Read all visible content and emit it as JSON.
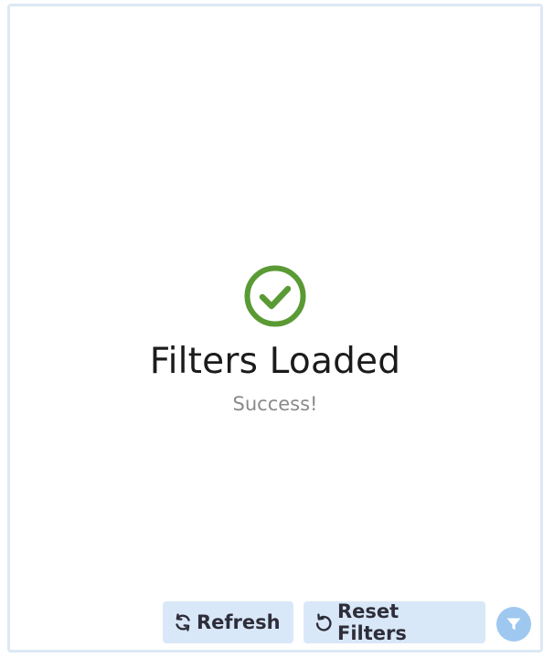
{
  "status": {
    "title": "Filters Loaded",
    "message": "Success!",
    "icon": "check-circle-icon",
    "icon_color": "#5a9a34"
  },
  "toolbar": {
    "refresh_label": "Refresh",
    "refresh_icon": "refresh-icon",
    "reset_label": "Reset Filters",
    "reset_icon": "undo-icon",
    "filter_icon": "filter-icon"
  },
  "colors": {
    "button_bg": "#d9e8f8",
    "fab_bg": "#9ec8f0",
    "panel_border": "#dde8f4"
  }
}
